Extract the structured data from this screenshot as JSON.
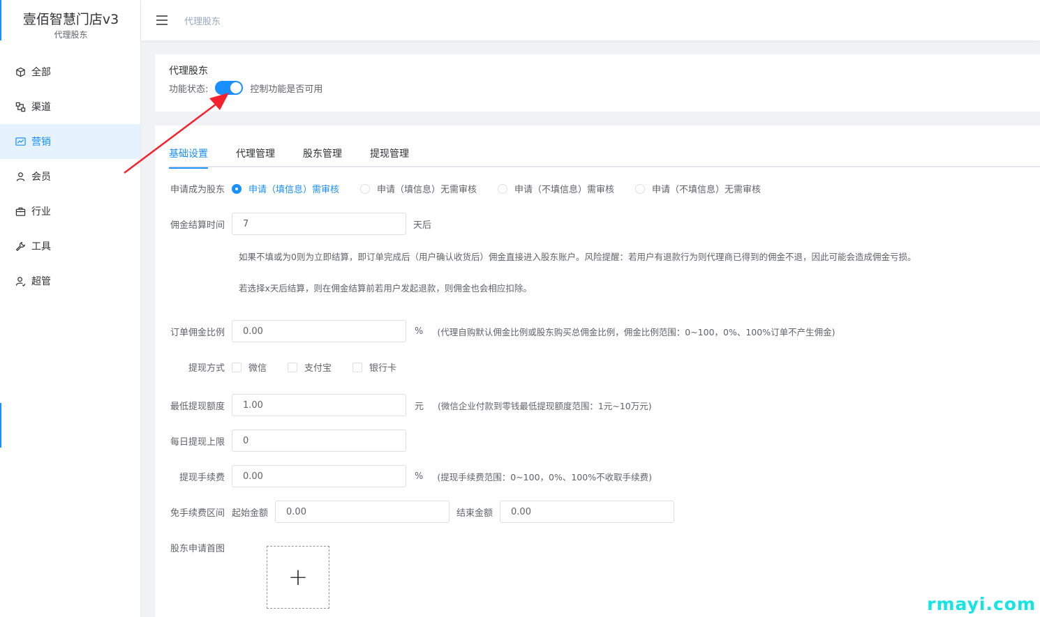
{
  "sidebar": {
    "brand_name": "壹佰智慧门店v3",
    "brand_sub": "代理股东",
    "items": [
      {
        "label": "全部",
        "icon": "cube-icon"
      },
      {
        "label": "渠道",
        "icon": "channel-icon"
      },
      {
        "label": "营销",
        "icon": "chart-icon",
        "active": true
      },
      {
        "label": "会员",
        "icon": "user-icon"
      },
      {
        "label": "行业",
        "icon": "briefcase-icon"
      },
      {
        "label": "工具",
        "icon": "wrench-icon"
      },
      {
        "label": "超管",
        "icon": "admin-icon"
      }
    ]
  },
  "header": {
    "breadcrumb": "代理股东"
  },
  "status_card": {
    "title": "代理股东",
    "status_label": "功能状态:",
    "switch_on": true,
    "status_desc": "控制功能是否可用"
  },
  "tabs": [
    {
      "label": "基础设置",
      "active": true
    },
    {
      "label": "代理管理"
    },
    {
      "label": "股东管理"
    },
    {
      "label": "提现管理"
    }
  ],
  "form": {
    "apply": {
      "label": "申请成为股东",
      "options": [
        {
          "label": "申请（填信息）需审核",
          "checked": true
        },
        {
          "label": "申请（填信息）无需审核"
        },
        {
          "label": "申请（不填信息）需审核"
        },
        {
          "label": "申请（不填信息）无需审核"
        }
      ]
    },
    "settle": {
      "label": "佣金结算时间",
      "value": "7",
      "suffix": "天后",
      "note1": "如果不填或为0则为立即结算，即订单完成后（用户确认收货后）佣金直接进入股东账户。风险提醒：若用户有退款行为则代理商已得到的佣金不退，因此可能会造成佣金亏损。",
      "note2": "若选择x天后结算，则在佣金结算前若用户发起退款，则佣金也会相应扣除。"
    },
    "ratio": {
      "label": "订单佣金比例",
      "value": "0.00",
      "suffix": "%",
      "hint": "(代理自购默认佣金比例或股东购买总佣金比例，佣金比例范围：0~100，0%、100%订单不产生佣金)"
    },
    "withdraw_method": {
      "label": "提现方式",
      "options": [
        "微信",
        "支付宝",
        "银行卡"
      ]
    },
    "min_withdraw": {
      "label": "最低提现额度",
      "value": "1.00",
      "suffix": "元",
      "hint": "(微信企业付款到零钱最低提现额度范围：1元~10万元)"
    },
    "daily_limit": {
      "label": "每日提现上限",
      "value": "0"
    },
    "fee": {
      "label": "提现手续费",
      "value": "0.00",
      "suffix": "%",
      "hint": "(提现手续费范围：0~100，0%、100%不收取手续费)"
    },
    "free_range": {
      "label": "免手续费区间",
      "start_label": "起始金额",
      "start_value": "0.00",
      "end_label": "结束金额",
      "end_value": "0.00"
    },
    "banner": {
      "label": "股东申请首图",
      "upload_symbol": "+"
    }
  },
  "watermark": "rmayi.com",
  "colors": {
    "accent": "#1890ff",
    "arrow": "#f5222d",
    "watermark": "#14e4e4"
  }
}
